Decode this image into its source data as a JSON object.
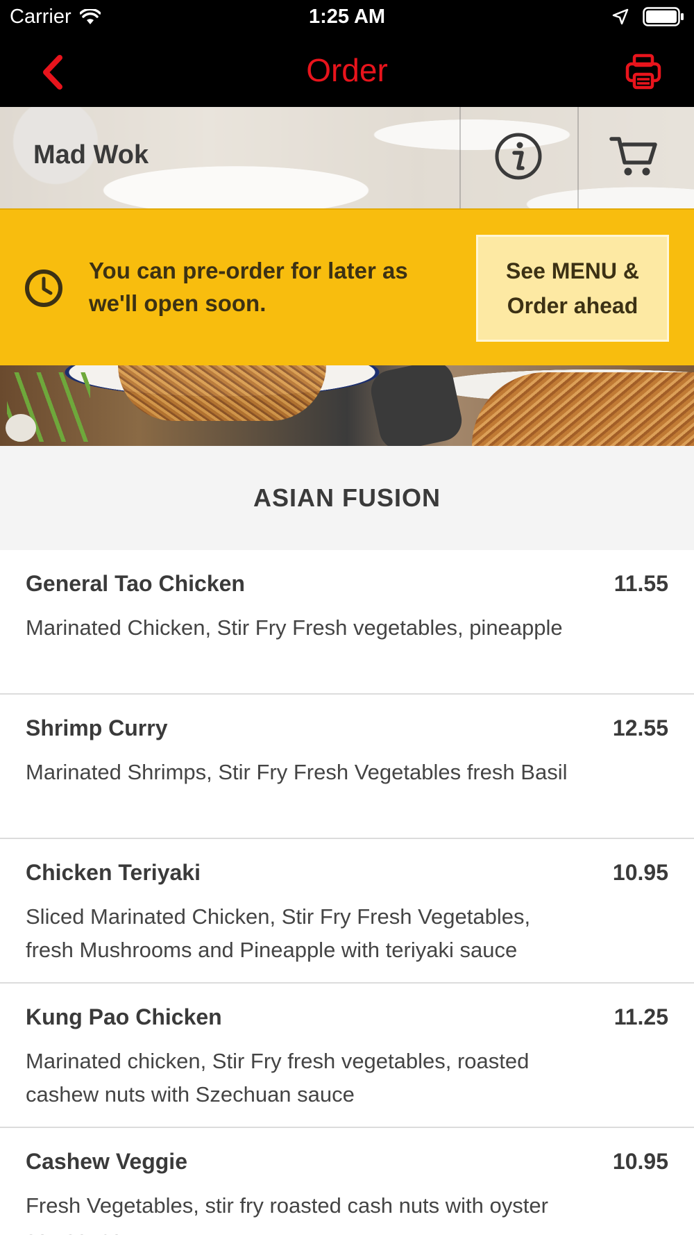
{
  "status_bar": {
    "carrier": "Carrier",
    "time": "1:25 AM"
  },
  "nav": {
    "title": "Order",
    "accent_color": "#e8141c"
  },
  "restaurant": {
    "name": "Mad Wok"
  },
  "preorder_banner": {
    "message": "You can pre-order for later as we'll open soon.",
    "button_line1": "See MENU &",
    "button_line2": "Order ahead",
    "background_color": "#f8bd0e"
  },
  "category": {
    "title": "ASIAN FUSION"
  },
  "menu_items": [
    {
      "name": "General Tao Chicken",
      "price": "11.55",
      "description": "Marinated Chicken, Stir Fry Fresh vegetables, pineapple"
    },
    {
      "name": "Shrimp Curry",
      "price": "12.55",
      "description": "Marinated Shrimps, Stir Fry Fresh Vegetables fresh Basil"
    },
    {
      "name": "Chicken Teriyaki",
      "price": "10.95",
      "description": "Sliced Marinated Chicken, Stir Fry Fresh Vegetables, fresh Mushrooms and Pineapple with teriyaki sauce"
    },
    {
      "name": "Kung Pao Chicken",
      "price": "11.25",
      "description": "Marinated chicken, Stir Fry fresh vegetables, roasted cashew nuts with Szechuan sauce"
    },
    {
      "name": "Cashew Veggie",
      "price": "10.95",
      "description": "Fresh Vegetables, stir fry roasted cash nuts with oyster soy sauce"
    }
  ],
  "icons": {
    "back": "chevron-left-icon",
    "print": "printer-icon",
    "info": "info-icon",
    "cart": "cart-icon",
    "clock": "clock-icon",
    "wifi": "wifi-icon",
    "location": "location-arrow-icon",
    "battery": "battery-icon"
  }
}
